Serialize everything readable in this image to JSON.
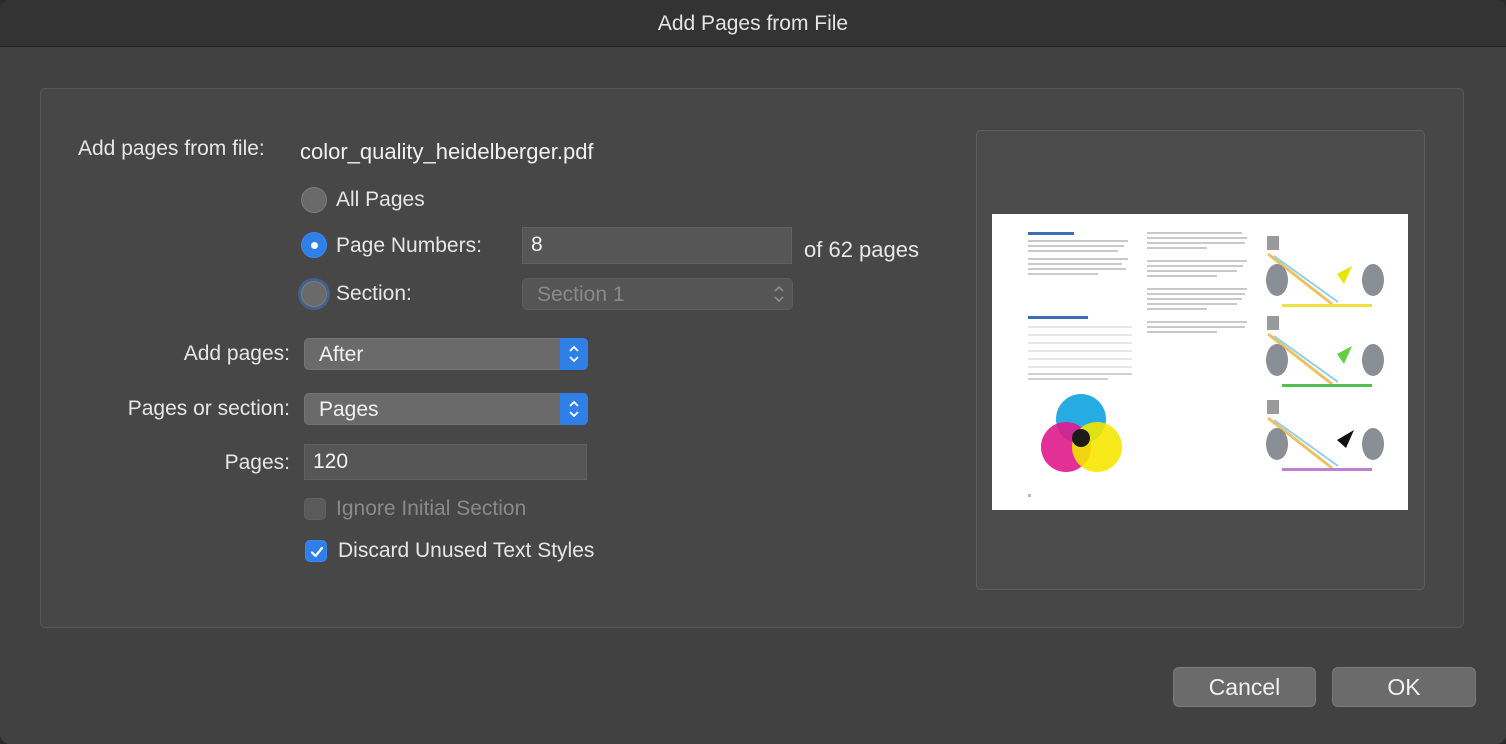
{
  "window": {
    "title": "Add Pages from File"
  },
  "file": {
    "label": "Add pages from file:",
    "filename": "color_quality_heidelberger.pdf"
  },
  "range": {
    "all_pages_label": "All Pages",
    "page_numbers_label": "Page Numbers:",
    "page_numbers_value": "8",
    "of_pages_text": "of 62 pages",
    "section_label": "Section:",
    "section_value": "Section 1",
    "selected": "page_numbers"
  },
  "add_pages": {
    "label": "Add pages:",
    "value": "After"
  },
  "pages_or_section": {
    "label": "Pages or section:",
    "value": "Pages"
  },
  "pages": {
    "label": "Pages:",
    "value": "120"
  },
  "options": {
    "ignore_initial_section": {
      "label": "Ignore Initial Section",
      "checked": false,
      "enabled": false
    },
    "discard_unused_text_styles": {
      "label": "Discard Unused Text Styles",
      "checked": true
    }
  },
  "buttons": {
    "cancel": "Cancel",
    "ok": "OK"
  },
  "colors": {
    "accent": "#2f7fe8",
    "cyan": "#1aa7e0",
    "magenta": "#e0198c",
    "yellow": "#f5e500"
  }
}
